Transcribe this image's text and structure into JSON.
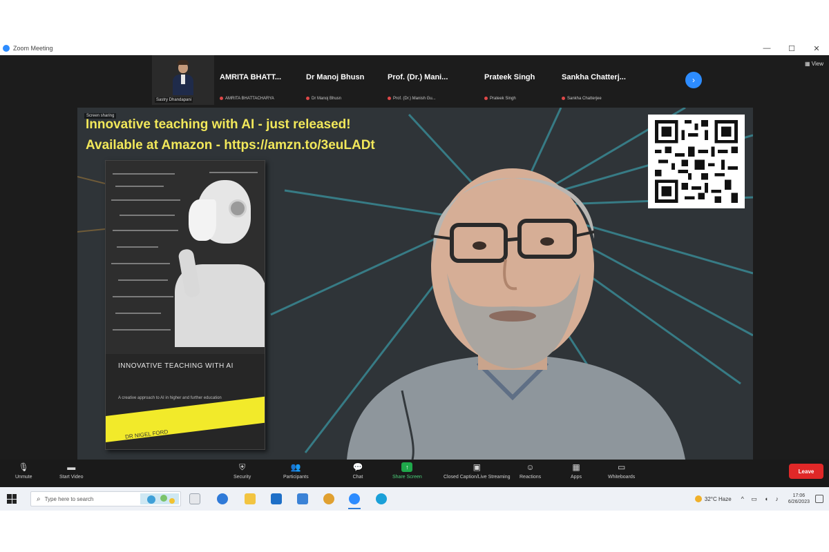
{
  "window": {
    "title": "Zoom Meeting",
    "controls": [
      "—",
      "☐",
      "✕"
    ]
  },
  "participants": {
    "thumbnail_name": "Sastry Dhandapani",
    "tiles": [
      {
        "name": "AMRITA BHATT...",
        "sub": "AMRITA BHATTACHARYA"
      },
      {
        "name": "Dr Manoj Bhusn",
        "sub": "Dr Manoj Bhusn"
      },
      {
        "name": "Prof. (Dr.) Mani...",
        "sub": "Prof. (Dr.) Manish Gu..."
      },
      {
        "name": "Prateek Singh",
        "sub": "Prateek Singh"
      },
      {
        "name": "Sankha Chatterj...",
        "sub": "Sankha Chatterjee"
      }
    ],
    "next_icon": "›",
    "view_label": "View"
  },
  "shared": {
    "sharing_tag": "Screen sharing",
    "banner_line1": "Innovative teaching with AI - just released!",
    "banner_line2": "Available at Amazon - https://amzn.to/3euLADt",
    "book_title": "INNOVATIVE TEACHING WITH AI",
    "book_subtitle": "A creative approach to AI in higher and further education",
    "book_author": "DR NIGEL FORD"
  },
  "toolbar": {
    "items": [
      {
        "icon": "microphone-icon",
        "label": "Unmute"
      },
      {
        "icon": "video-camera-icon",
        "label": "Start Video"
      },
      {
        "icon": "shield-icon",
        "label": "Security"
      },
      {
        "icon": "participants-icon",
        "label": "Participants"
      },
      {
        "icon": "chat-icon",
        "label": "Chat"
      },
      {
        "icon": "share-screen-icon",
        "label": "Share Screen"
      },
      {
        "icon": "summary-icon",
        "label": "Closed Caption/Live Streaming"
      },
      {
        "icon": "reactions-icon",
        "label": "Reactions"
      },
      {
        "icon": "apps-icon",
        "label": "Apps"
      },
      {
        "icon": "whiteboards-icon",
        "label": "Whiteboards"
      }
    ],
    "end_label": "Leave"
  },
  "taskbar": {
    "search_placeholder": "Type here to search",
    "weather": "32°C Haze",
    "time": "17:06",
    "date": "6/26/2023"
  },
  "colors": {
    "banner_text": "#f2e85a",
    "accent": "#2d8cff",
    "share_green": "#1fa84b",
    "end_red": "#e02828"
  }
}
